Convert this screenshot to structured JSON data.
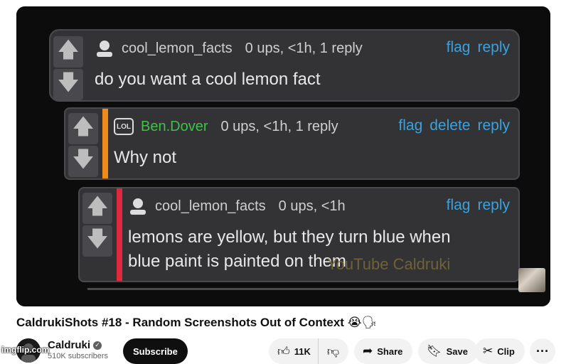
{
  "video": {
    "comments": [
      {
        "username": "cool_lemon_facts",
        "stats": "0 ups, <1h, 1 reply",
        "actions": [
          "flag",
          "reply"
        ],
        "text": "do you want a cool lemon fact",
        "icon": "user-icon"
      },
      {
        "username": "Ben.Dover",
        "stats": "0 ups, <1h, 1 reply",
        "actions": [
          "flag",
          "delete",
          "reply"
        ],
        "text": "Why not",
        "icon": "lol-icon",
        "badge": "LOL"
      },
      {
        "username": "cool_lemon_facts",
        "stats": "0 ups, <1h",
        "actions": [
          "flag",
          "reply"
        ],
        "text_line1": "lemons are yellow, but they turn blue when",
        "text_line2": "blue paint is painted on them",
        "icon": "user-icon"
      }
    ],
    "watermark": "YouTube Caldruki",
    "colors": {
      "background": "#333336",
      "link": "#3da2dc",
      "green_user": "#3fc247",
      "orange_bar": "#f08a1a",
      "red_bar": "#e0283c"
    }
  },
  "title": "CaldrukiShots #18 - Random Screenshots Out of Context",
  "title_emoji": "😭🗣",
  "channel": {
    "name": "Caldruki",
    "verified_mark": "✓",
    "subscribers": "510K subscribers",
    "subscribe_label": "Subscribe"
  },
  "actions": {
    "likes": "11K",
    "share": "Share",
    "save": "Save",
    "clip": "Clip",
    "more": "···"
  },
  "imgflip_watermark": "imgflip.com"
}
